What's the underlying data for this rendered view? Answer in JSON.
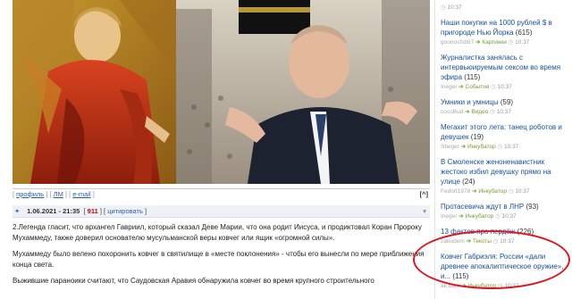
{
  "post": {
    "profile_links": [
      "профиль",
      "ЛМ",
      "e-mail"
    ],
    "collapse": "[^]",
    "date": "1.06.2021 - 21:35",
    "number": "911",
    "cite": "цитировать",
    "paragraphs": [
      "2.Легенда гласит, что архангел Гавриил, который сказал Деве Марии, что она родит Иисуса, и продиктовал Коран Пророку Мухаммеду, также доверил основателю мусульманской веры ковчег или ящик «огромной силы».",
      "Мухаммеду было велено похоронить ковчег в святилище в «месте поклонения» - чтобы его вынесли по мере приближения конца света.",
      "Выжившие параноики считают, что Саудовская Аравия обнаружила ковчег во время крупного строительного"
    ]
  },
  "sidebar": {
    "items": [
      {
        "title": "",
        "count": "",
        "user": "",
        "category": "",
        "time": "10:37"
      },
      {
        "title": "Наши покупки на 1000 рублей $ в пригороде Нью Йорка",
        "count": "(615)",
        "user": "goonosfsb67",
        "category": "Картинки",
        "time": "10:37"
      },
      {
        "title": "Журналистка занялась с интервьюируемым сексом во время эфира",
        "count": "(115)",
        "user": "Ineger",
        "category": "События",
        "time": "10:37"
      },
      {
        "title": "Умники и умницы",
        "count": "(59)",
        "user": "cocoBud",
        "category": "Видео",
        "time": "10:37"
      },
      {
        "title": "Мегахит этого лета: танец роботов и девушек",
        "count": "(19)",
        "user": "Sbeger",
        "category": "Инкубатор",
        "time": "10:37"
      },
      {
        "title": "В Смоленске женоненавистник жестоко избил девушку прямо на улице",
        "count": "(24)",
        "user": "Fedort1978",
        "category": "Инкубатор",
        "time": "10:37"
      },
      {
        "title": "Протасевича ждут в ЛНР",
        "count": "(93)",
        "user": "Ineger",
        "category": "Инкубатор",
        "time": "10:37"
      },
      {
        "title": "13 фактов про пердёж",
        "count": "(226)",
        "user": "zabudem",
        "category": "Тексты",
        "time": "10:37"
      },
      {
        "title": "Ковчег Габриэля: России «дали древнее апокалиптическое оружие», и...",
        "count": "(115)",
        "user": "ak.oam",
        "category": "Инкубатор",
        "time": "10:37"
      }
    ]
  },
  "colors": {
    "link": "#1a50a0",
    "highlight": "#e0141e",
    "badge": "#cc0000"
  }
}
